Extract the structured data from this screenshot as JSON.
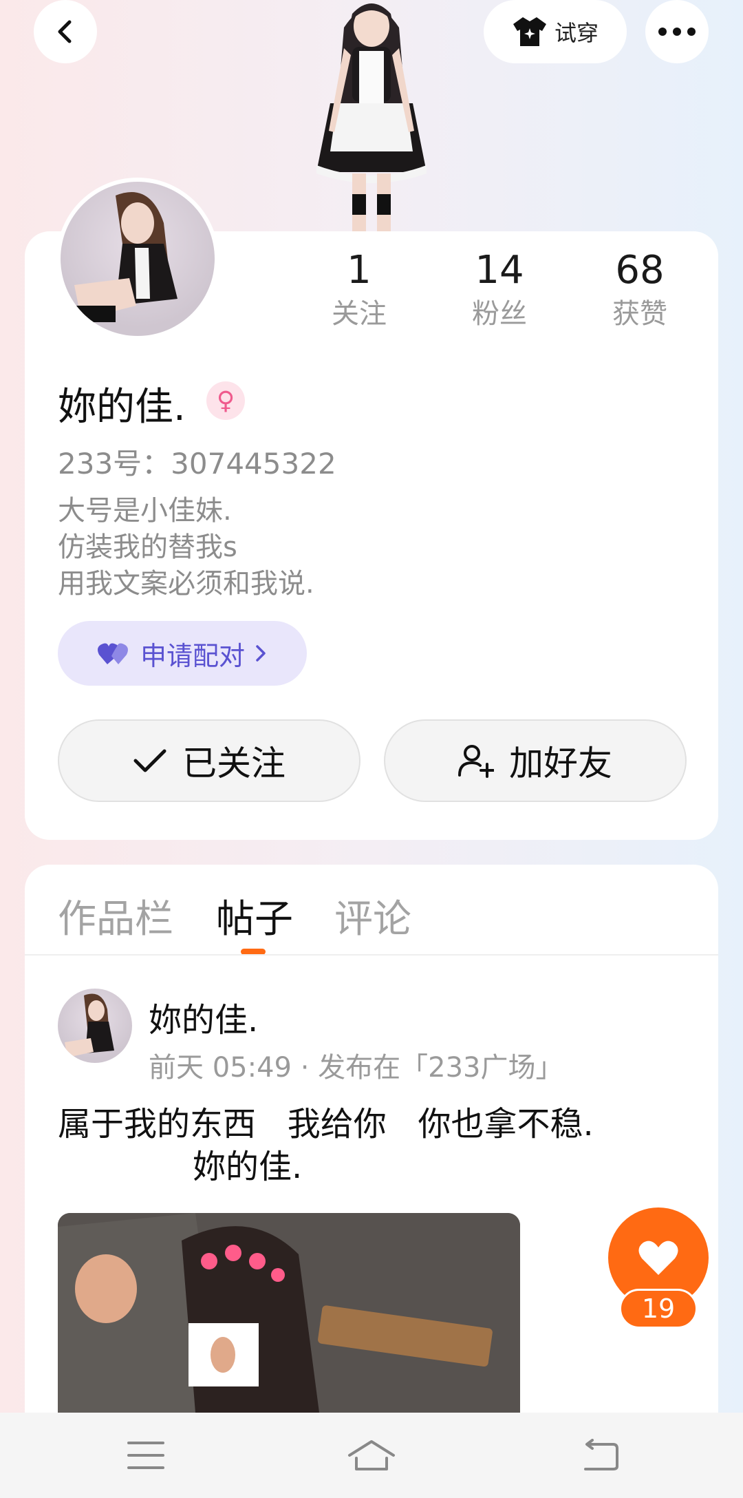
{
  "header": {
    "back_icon": "chevron-left-icon",
    "try_on_label": "试穿",
    "more_icon": "more-horizontal-icon"
  },
  "profile": {
    "stats": [
      {
        "value": "1",
        "label": "关注"
      },
      {
        "value": "14",
        "label": "粉丝"
      },
      {
        "value": "68",
        "label": "获赞"
      }
    ],
    "username": "妳的佳.",
    "gender": "♀",
    "uid_label": "233号：",
    "uid_value": "307445322",
    "bio_lines": [
      "大号是小佳妹.",
      "仿装我的替我s",
      "用我文案必须和我说."
    ],
    "pair_button": "申请配对",
    "follow_button": "已关注",
    "add_friend_button": "加好友",
    "colors": {
      "accent": "#ff6a13",
      "pair_text": "#5a52d1",
      "pair_bg": "#e9e6fb"
    }
  },
  "tabs": [
    {
      "label": "作品栏",
      "active": false
    },
    {
      "label": "帖子",
      "active": true
    },
    {
      "label": "评论",
      "active": false
    }
  ],
  "post": {
    "author": "妳的佳.",
    "meta": "前天 05:49 · 发布在「233广场」",
    "text_line1": "属于我的东西   我给你   你也拿不稳.",
    "text_line2": "妳的佳.",
    "like_count": "19"
  },
  "bottom_nav": {
    "menu_icon": "menu-icon",
    "home_icon": "home-icon",
    "back_icon": "back-icon"
  }
}
